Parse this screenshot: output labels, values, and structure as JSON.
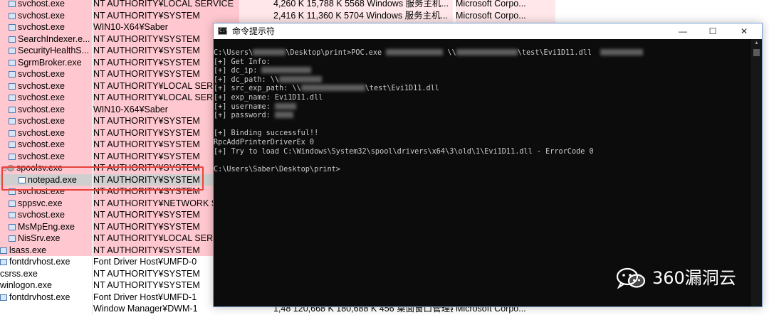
{
  "process_rows": [
    {
      "name": "svchost.exe",
      "user": "NT AUTHORITY¥LOCAL SERVICE",
      "details": "4,260 K   15,788 K 5568 Windows 服务主机...",
      "company": "Microsoft Corpo...",
      "style": "pink",
      "icon": "window",
      "indent": 0
    },
    {
      "name": "svchost.exe",
      "user": "NT AUTHORITY¥SYSTEM",
      "details": "2,416 K   11,360 K 5704 Windows 服务主机...",
      "company": "Microsoft Corpo...",
      "style": "pink",
      "icon": "window",
      "indent": 0
    },
    {
      "name": "svchost.exe",
      "user": "WIN10-X64¥Saber",
      "details": "",
      "company": "",
      "style": "pink",
      "icon": "window",
      "indent": 0
    },
    {
      "name": "SearchIndexer.e...",
      "user": "NT AUTHORITY¥SYSTEM",
      "details": "",
      "company": "",
      "style": "pink",
      "icon": "search",
      "indent": 0
    },
    {
      "name": "SecurityHealthS...",
      "user": "NT AUTHORITY¥SYSTEM",
      "details": "",
      "company": "",
      "style": "pink",
      "icon": "window",
      "indent": 0
    },
    {
      "name": "SgrmBroker.exe",
      "user": "NT AUTHORITY¥SYSTEM",
      "details": "",
      "company": "",
      "style": "pink",
      "icon": "window",
      "indent": 0
    },
    {
      "name": "svchost.exe",
      "user": "NT AUTHORITY¥SYSTEM",
      "details": "",
      "company": "",
      "style": "pink",
      "icon": "window",
      "indent": 0
    },
    {
      "name": "svchost.exe",
      "user": "NT AUTHORITY¥LOCAL SERVICE",
      "details": "",
      "company": "",
      "style": "pink",
      "icon": "window",
      "indent": 0
    },
    {
      "name": "svchost.exe",
      "user": "NT AUTHORITY¥LOCAL SERVICE",
      "details": "",
      "company": "",
      "style": "pink",
      "icon": "window",
      "indent": 0
    },
    {
      "name": "svchost.exe",
      "user": "WIN10-X64¥Saber",
      "details": "",
      "company": "",
      "style": "pink",
      "icon": "window",
      "indent": 0
    },
    {
      "name": "svchost.exe",
      "user": "NT AUTHORITY¥SYSTEM",
      "details": "",
      "company": "",
      "style": "pink",
      "icon": "window",
      "indent": 0
    },
    {
      "name": "svchost.exe",
      "user": "NT AUTHORITY¥SYSTEM",
      "details": "",
      "company": "",
      "style": "pink",
      "icon": "window",
      "indent": 0
    },
    {
      "name": "svchost.exe",
      "user": "NT AUTHORITY¥SYSTEM",
      "details": "",
      "company": "",
      "style": "pink",
      "icon": "window",
      "indent": 0
    },
    {
      "name": "svchost.exe",
      "user": "NT AUTHORITY¥SYSTEM",
      "details": "",
      "company": "",
      "style": "pink",
      "icon": "window",
      "indent": 0
    },
    {
      "name": "spoolsv.exe",
      "user": "NT AUTHORITY¥SYSTEM",
      "details": "",
      "company": "",
      "style": "pink",
      "icon": "gear",
      "indent": 0,
      "expand": "⊟"
    },
    {
      "name": "notepad.exe",
      "user": "NT AUTHORITY¥SYSTEM",
      "details": "",
      "company": "",
      "style": "sel",
      "icon": "note",
      "indent": 1
    },
    {
      "name": "svchost.exe",
      "user": "NT AUTHORITY¥SYSTEM",
      "details": "",
      "company": "",
      "style": "pink",
      "icon": "window",
      "indent": 0
    },
    {
      "name": "sppsvc.exe",
      "user": "NT AUTHORITY¥NETWORK SERVICE",
      "details": "",
      "company": "",
      "style": "pink",
      "icon": "window",
      "indent": 0
    },
    {
      "name": "svchost.exe",
      "user": "NT AUTHORITY¥SYSTEM",
      "details": "",
      "company": "",
      "style": "pink",
      "icon": "window",
      "indent": 0
    },
    {
      "name": "MsMpEng.exe",
      "user": "NT AUTHORITY¥SYSTEM",
      "details": "",
      "company": "",
      "style": "pink",
      "icon": "window",
      "indent": 0
    },
    {
      "name": "NisSrv.exe",
      "user": "NT AUTHORITY¥LOCAL SERVICE",
      "details": "",
      "company": "",
      "style": "pink",
      "icon": "window",
      "indent": 0
    },
    {
      "name": "lsass.exe",
      "user": "NT AUTHORITY¥SYSTEM",
      "details": "",
      "company": "",
      "style": "pink",
      "icon": "window",
      "indent": -1
    },
    {
      "name": "fontdrvhost.exe",
      "user": "Font Driver Host¥UMFD-0",
      "details": "",
      "company": "",
      "style": "white",
      "icon": "window",
      "indent": -1
    },
    {
      "name": "csrss.exe",
      "user": "NT AUTHORITY¥SYSTEM",
      "details": "",
      "company": "",
      "style": "white",
      "icon": "none",
      "indent": -1
    },
    {
      "name": "winlogon.exe",
      "user": "NT AUTHORITY¥SYSTEM",
      "details": "",
      "company": "",
      "style": "white",
      "icon": "none",
      "indent": -1
    },
    {
      "name": "fontdrvhost.exe",
      "user": "Font Driver Host¥UMFD-1",
      "details": "",
      "company": "",
      "style": "white",
      "icon": "window",
      "indent": -1
    },
    {
      "name": "",
      "user": "Window Manager¥DWM-1",
      "details": "1,48  120,668 K 180,688 K  456 桌面窗口管理器",
      "company": "Microsoft Corpo...",
      "style": "white",
      "icon": "none",
      "indent": -1
    }
  ],
  "console": {
    "title": "命令提示符",
    "title_icon": "C:\\",
    "minimize": "—",
    "maximize": "☐",
    "close": "✕",
    "lines": [
      {
        "text": "C:\\Users\\"
      },
      {
        "text": "[+] Get Info:"
      },
      {
        "text": "[+] dc_ip:"
      },
      {
        "text": "[+] dc_path: \\\\"
      },
      {
        "text": "[+] src_exp_path: \\\\"
      },
      {
        "text": "[+] exp_name: Evi1D11.dll"
      },
      {
        "text": "[+] username:"
      },
      {
        "text": "[+] password:"
      },
      {
        "text": ""
      },
      {
        "text": "[+] Binding successful!!"
      },
      {
        "text": "RpcAddPrinterDriverEx 0"
      },
      {
        "text": "[+] Try to load C:\\Windows\\System32\\spool\\drivers\\x64\\3\\old\\1\\Evi1D11.dll - ErrorCode 0"
      },
      {
        "text": ""
      },
      {
        "text": "C:\\Users\\Saber\\Desktop\\print>"
      }
    ],
    "line0_mid": "\\Desktop\\print>POC.exe",
    "line0_mid2": "\\\\",
    "line0_end": "\\test\\Evi1D11.dll",
    "line4_end": "\\test\\Evi1D11.dll"
  },
  "watermark": {
    "text": "360漏洞云"
  },
  "colors": {
    "highlight": "#e8443c",
    "pink_row": "#ffc8d0",
    "console_bg": "#0c0c0c",
    "console_text": "#cccccc"
  }
}
